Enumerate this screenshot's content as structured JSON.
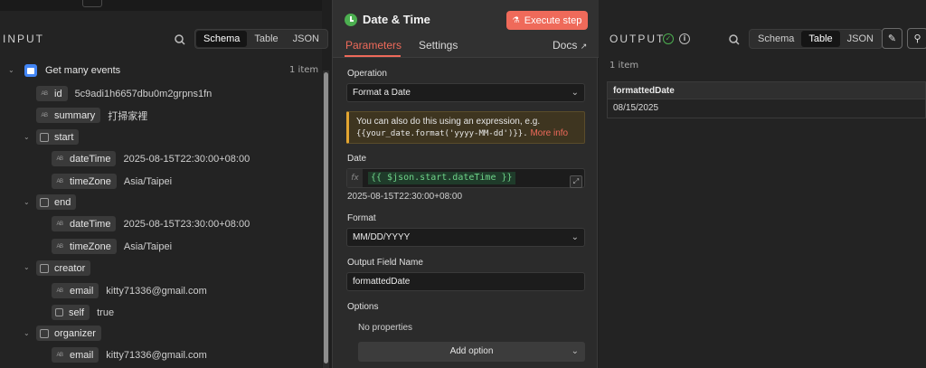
{
  "input": {
    "title": "INPUT",
    "views": [
      "Schema",
      "Table",
      "JSON"
    ],
    "active_view": "Schema",
    "node_name": "Get many events",
    "item_count": "1 item",
    "fields": {
      "id": {
        "key": "id",
        "value": "5c9adi1h6657dbu0m2grpns1fn"
      },
      "summary": {
        "key": "summary",
        "value": "打掃家裡"
      },
      "start": {
        "key": "start"
      },
      "start_dateTime": {
        "key": "dateTime",
        "value": "2025-08-15T22:30:00+08:00"
      },
      "start_timeZone": {
        "key": "timeZone",
        "value": "Asia/Taipei"
      },
      "end": {
        "key": "end"
      },
      "end_dateTime": {
        "key": "dateTime",
        "value": "2025-08-15T23:30:00+08:00"
      },
      "end_timeZone": {
        "key": "timeZone",
        "value": "Asia/Taipei"
      },
      "creator": {
        "key": "creator"
      },
      "creator_email": {
        "key": "email",
        "value": "kitty71336@gmail.com"
      },
      "creator_self": {
        "key": "self",
        "value": "true"
      },
      "organizer": {
        "key": "organizer"
      },
      "organizer_email": {
        "key": "email",
        "value": "kitty71336@gmail.com"
      }
    },
    "type_badge": "AB"
  },
  "node": {
    "title": "Date & Time",
    "execute_label": "Execute step",
    "tabs": [
      "Parameters",
      "Settings"
    ],
    "docs_label": "Docs",
    "operation_label": "Operation",
    "operation_value": "Format a Date",
    "notice_text": "You can also do this using an expression, e.g.",
    "notice_code": "{{your_date.format('yyyy-MM-dd')}}.",
    "notice_link": "More info",
    "date_label": "Date",
    "date_expression": "{{ $json.start.dateTime }}",
    "date_fx": "fx",
    "date_preview": "2025-08-15T22:30:00+08:00",
    "format_label": "Format",
    "format_value": "MM/DD/YYYY",
    "output_field_label": "Output Field Name",
    "output_field_value": "formattedDate",
    "options_label": "Options",
    "no_properties": "No properties",
    "add_option_label": "Add option"
  },
  "output": {
    "title": "OUTPUT",
    "views": [
      "Schema",
      "Table",
      "JSON"
    ],
    "active_view": "Table",
    "item_count": "1 item",
    "table": {
      "columns": [
        "formattedDate"
      ],
      "rows": [
        [
          "08/15/2025"
        ]
      ]
    }
  },
  "colors": {
    "accent": "#ef6a5a",
    "success": "#4caf50",
    "warning": "#e3a531"
  }
}
